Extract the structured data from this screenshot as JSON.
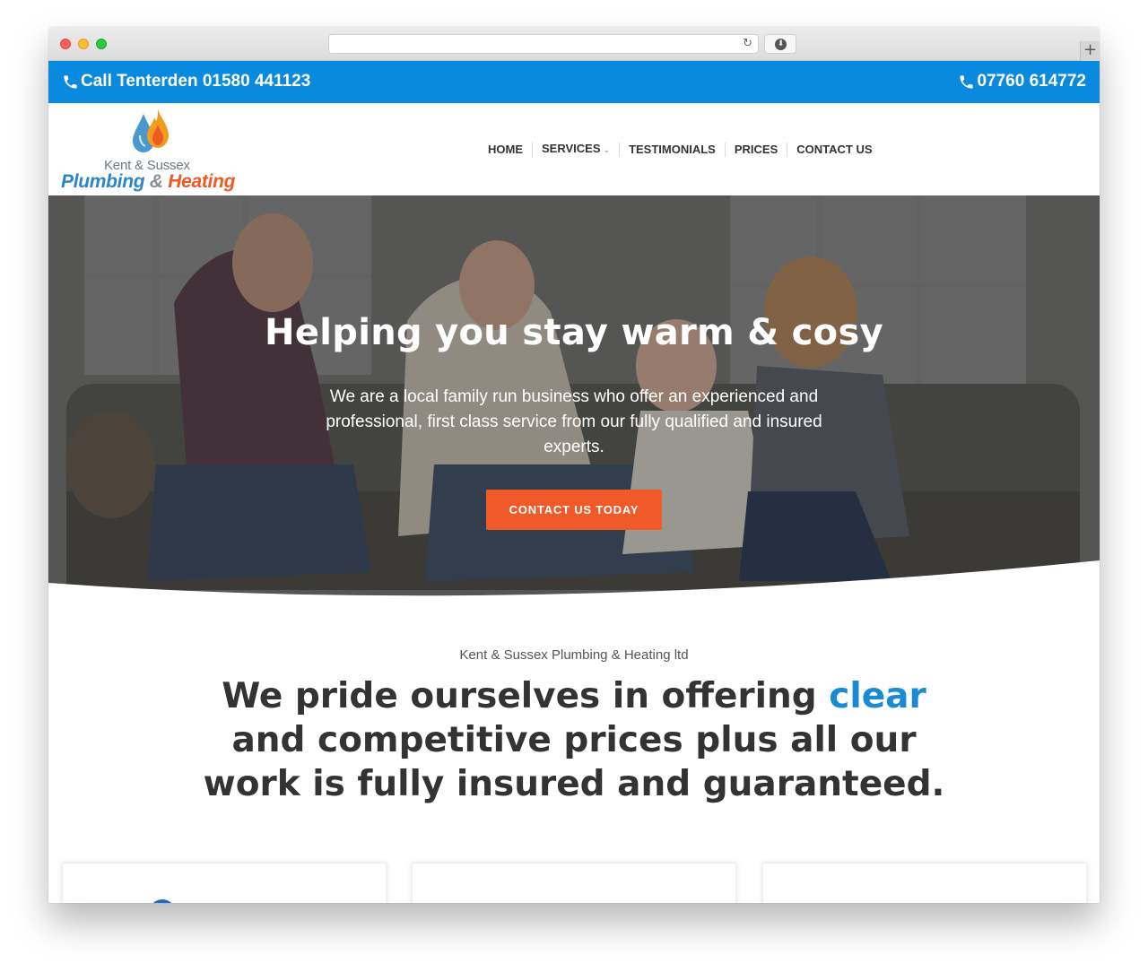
{
  "browser": {
    "url": "",
    "reload_icon": "reload-icon",
    "download_icon": "download-icon",
    "new_tab_icon": "plus-icon"
  },
  "topbar": {
    "left_phone": "Call Tenterden 01580 441123",
    "right_phone": "07760 614772",
    "icon": "phone-icon",
    "background": "#0a8ade"
  },
  "logo": {
    "sub": "Kent & Sussex",
    "main_1": "Plumbing",
    "main_amp": "&",
    "main_2": "Heating"
  },
  "nav": {
    "home": "HOME",
    "services": "SERVICES",
    "testimonials": "TESTIMONIALS",
    "prices": "PRICES",
    "contact": "CONTACT US"
  },
  "hero": {
    "title": "Helping you stay warm & cosy",
    "text": "We are a local family run business who offer an experienced and professional, first class service from our fully qualified and insured experts.",
    "button": "CONTACT US TODAY",
    "button_color": "#f05a28"
  },
  "intro": {
    "company": "Kent & Sussex Plumbing & Heating ltd",
    "headline_before": "We pride ourselves in offering ",
    "headline_highlight": "clear",
    "headline_after": " and competitive prices plus all our work is fully insured and guaranteed.",
    "highlight_color": "#1a8ad4"
  }
}
